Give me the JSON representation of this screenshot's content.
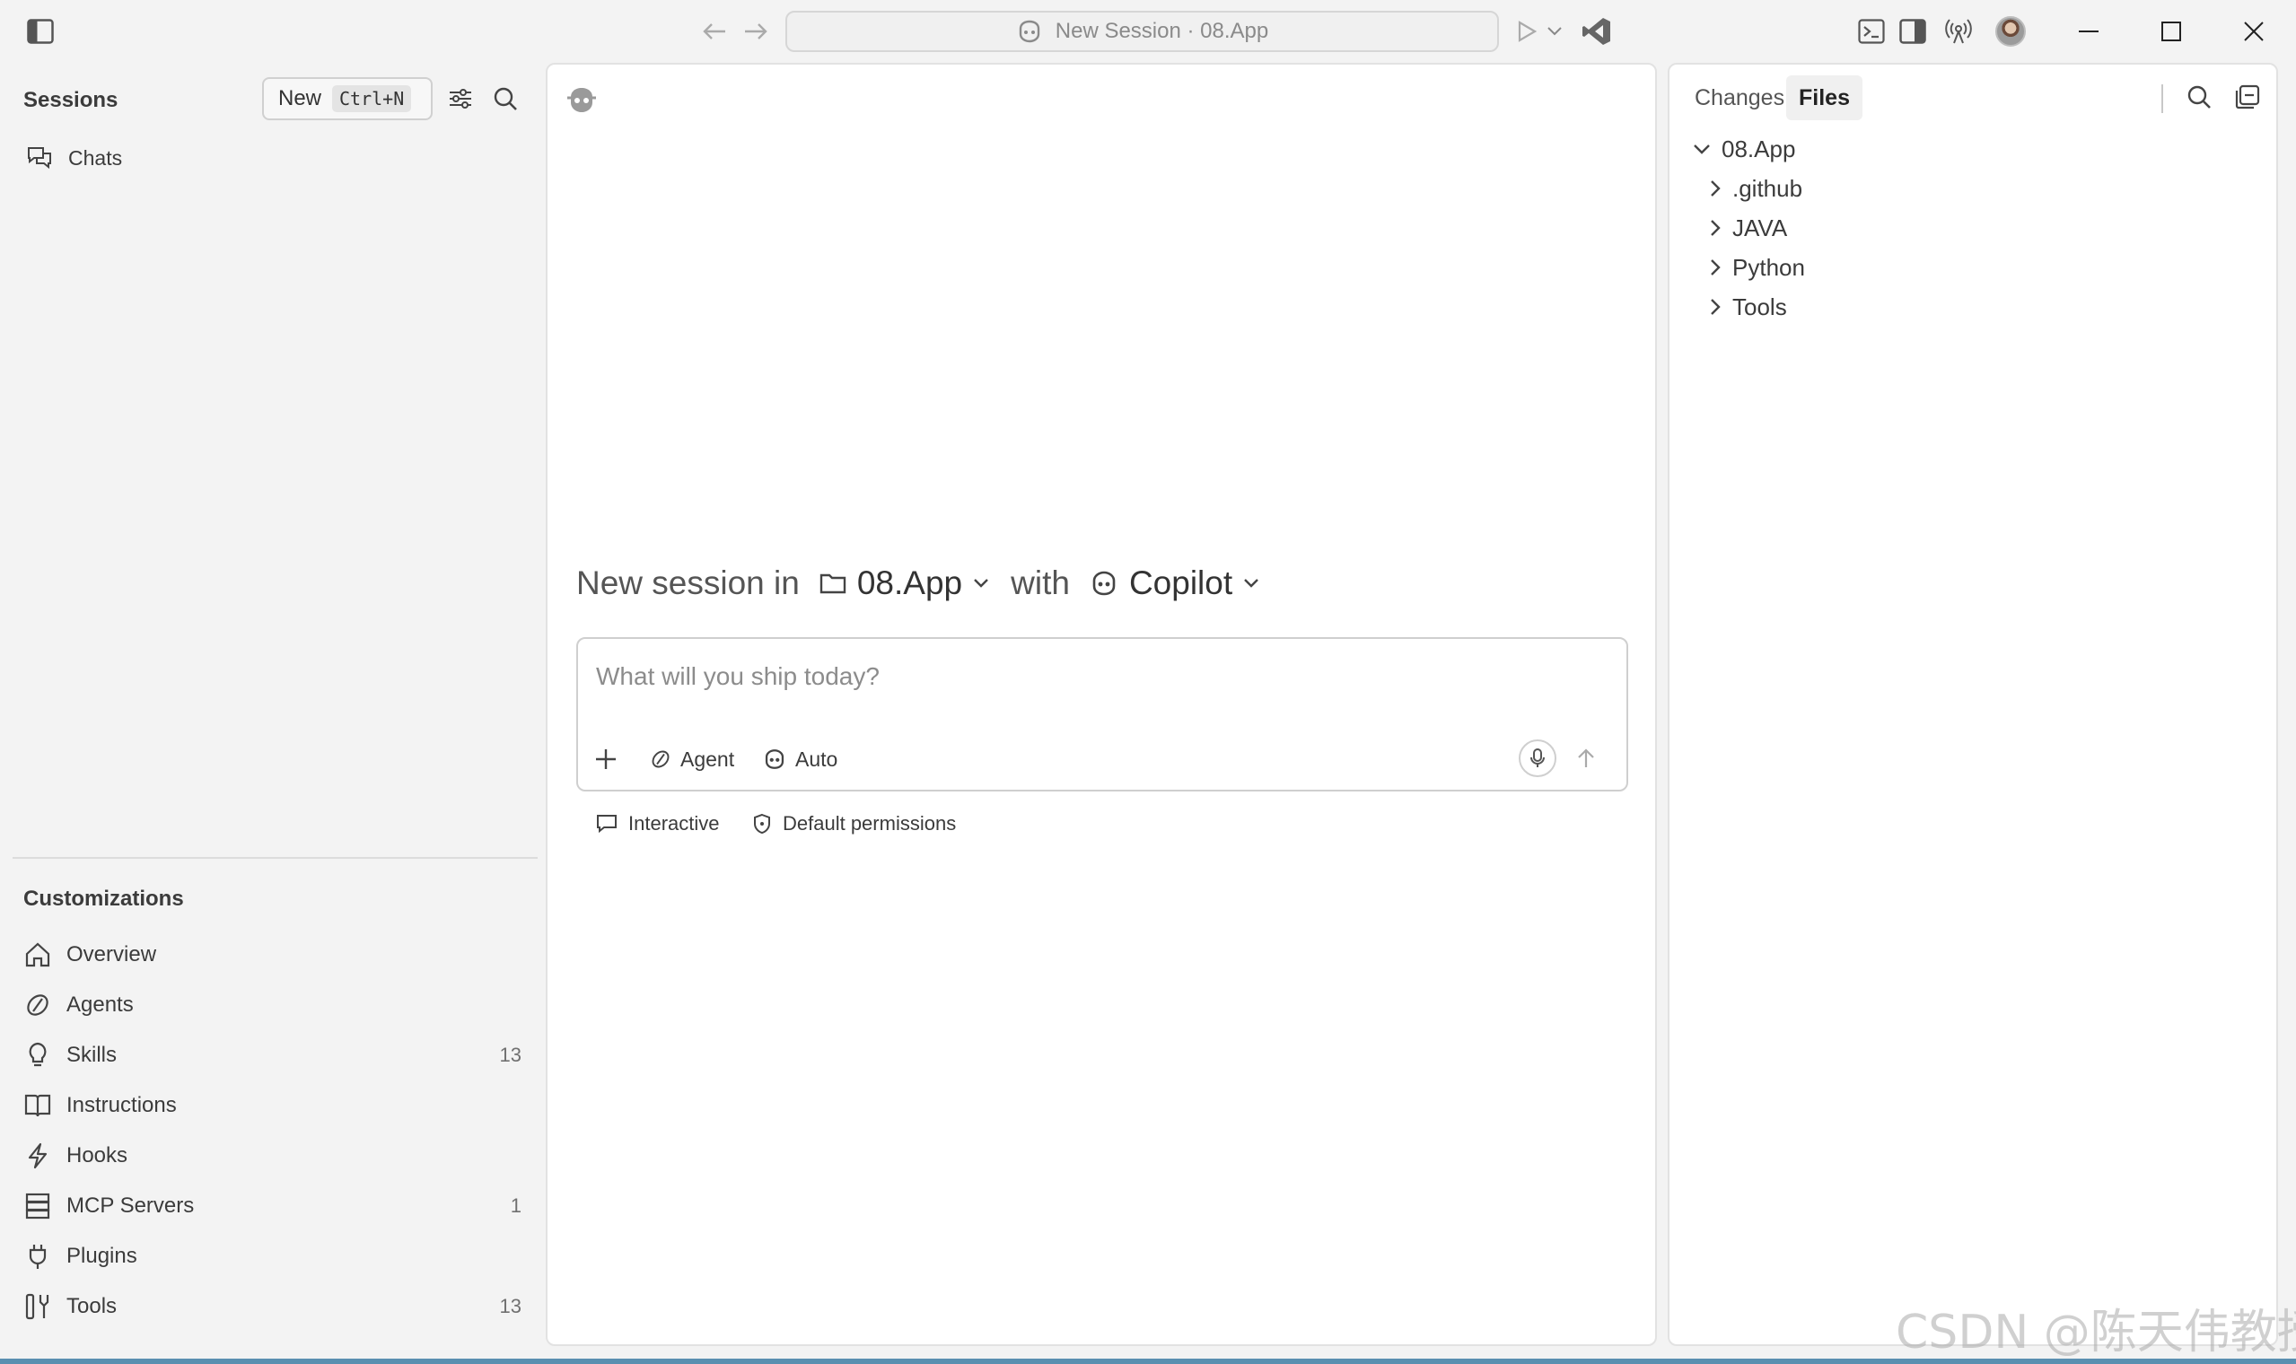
{
  "titlebar": {
    "command_center": "New Session · 08.App"
  },
  "sidebar": {
    "sessions_title": "Sessions",
    "new_button": "New",
    "new_shortcut": "Ctrl+N",
    "chats_label": "Chats",
    "customizations_title": "Customizations",
    "items": [
      {
        "label": "Overview",
        "count": "",
        "icon": "home-icon"
      },
      {
        "label": "Agents",
        "count": "",
        "icon": "agent-icon"
      },
      {
        "label": "Skills",
        "count": "13",
        "icon": "lightbulb-icon"
      },
      {
        "label": "Instructions",
        "count": "",
        "icon": "book-icon"
      },
      {
        "label": "Hooks",
        "count": "",
        "icon": "lightning-icon"
      },
      {
        "label": "MCP Servers",
        "count": "1",
        "icon": "server-icon"
      },
      {
        "label": "Plugins",
        "count": "",
        "icon": "plug-icon"
      },
      {
        "label": "Tools",
        "count": "13",
        "icon": "tools-icon"
      }
    ]
  },
  "main": {
    "hero_prefix": "New session in",
    "folder_name": "08.App",
    "hero_with": "with",
    "agent_name": "Copilot",
    "composer_placeholder": "What will you ship today?",
    "agent_mode": "Agent",
    "model": "Auto",
    "interactive_label": "Interactive",
    "permissions_label": "Default permissions"
  },
  "right_panel": {
    "tabs": [
      "Changes",
      "Files"
    ],
    "active_tab": "Files",
    "tree_root": "08.App",
    "tree_children": [
      ".github",
      "JAVA",
      "Python",
      "Tools"
    ]
  },
  "watermark": "CSDN @陈天伟教授",
  "colors": {
    "background": "#f3f3f3",
    "panel": "#ffffff",
    "accent_bottom": "#5a8fb0"
  }
}
